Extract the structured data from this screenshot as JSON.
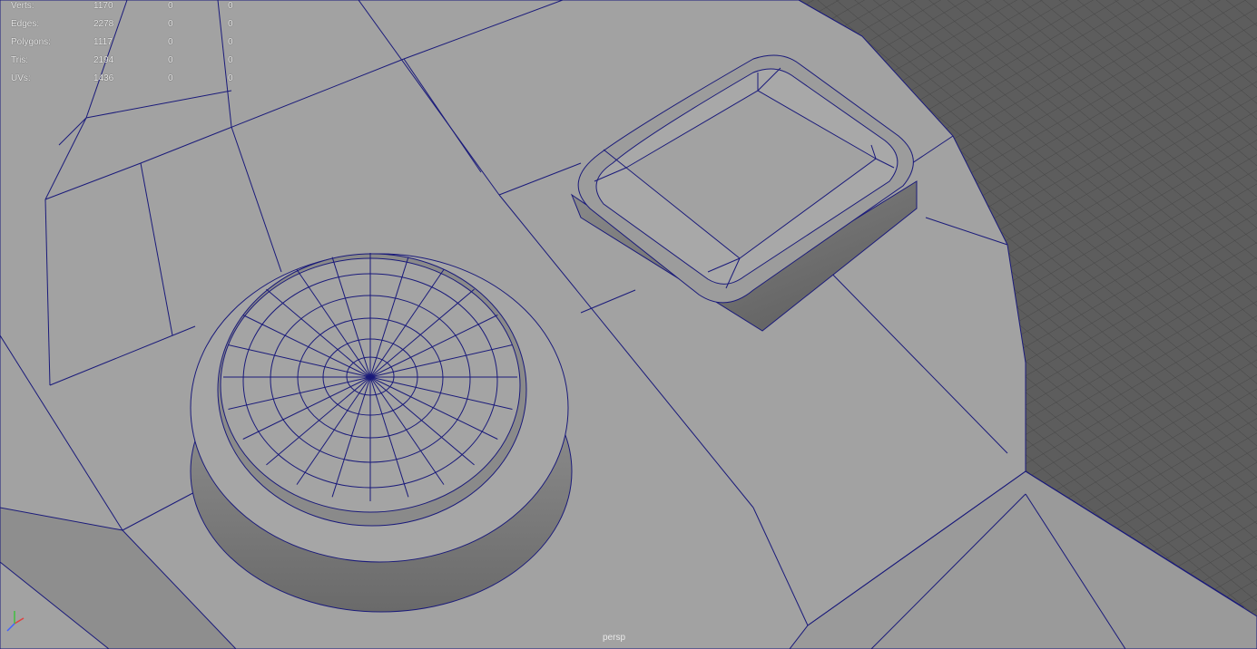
{
  "viewport": {
    "camera_name": "persp",
    "background_color": "#666666",
    "mesh_color": "#a0a0a0",
    "wireframe_color": "#1a1a7a",
    "grid_color": "#474747"
  },
  "hud": {
    "rows": [
      {
        "label": "Verts:",
        "v0": "1170",
        "v1": "0",
        "v2": "0"
      },
      {
        "label": "Edges:",
        "v0": "2278",
        "v1": "0",
        "v2": "0"
      },
      {
        "label": "Polygons:",
        "v0": "1117",
        "v1": "0",
        "v2": "0"
      },
      {
        "label": "Tris:",
        "v0": "2194",
        "v1": "0",
        "v2": "0"
      },
      {
        "label": "UVs:",
        "v0": "1436",
        "v1": "0",
        "v2": "0"
      }
    ]
  },
  "axis_gizmo": {
    "icon": "xyz-axis-icon"
  }
}
